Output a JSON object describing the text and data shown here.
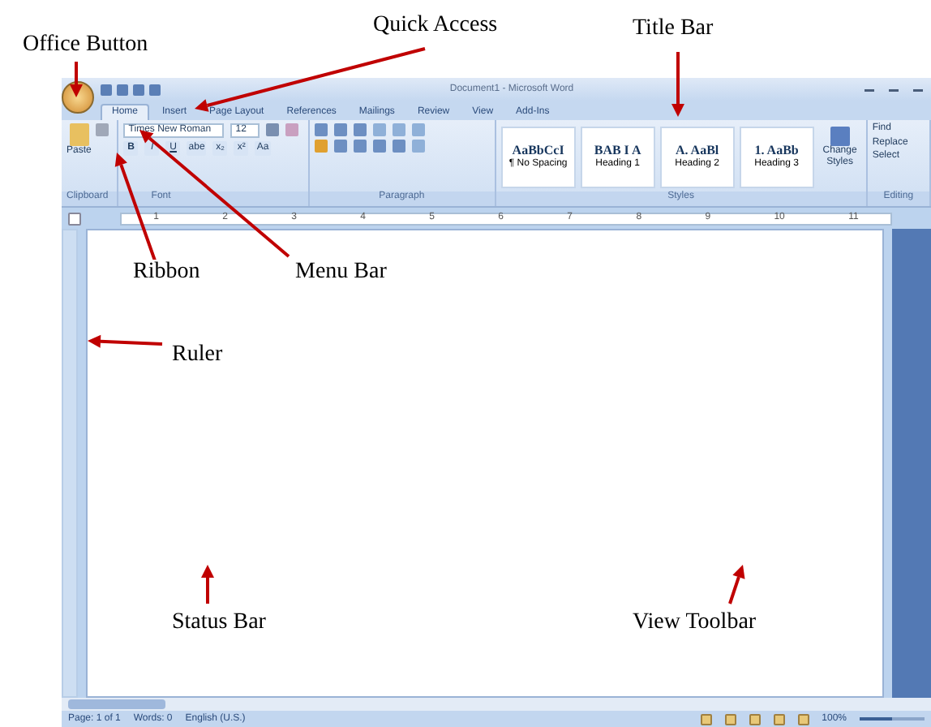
{
  "annotations": [
    {
      "label": "Office Button"
    },
    {
      "label": "Quick Access"
    },
    {
      "label": "Title Bar"
    },
    {
      "label": "Ribbon"
    },
    {
      "label": "Menu Bar"
    },
    {
      "label": "Ruler"
    },
    {
      "label": "Status Bar"
    },
    {
      "label": "View Toolbar"
    }
  ],
  "window": {
    "title": "Document1 - Microsoft Word"
  },
  "tabs": [
    {
      "label": "Home",
      "selected": true
    },
    {
      "label": "Insert",
      "selected": false
    },
    {
      "label": "Page Layout",
      "selected": false
    },
    {
      "label": "References",
      "selected": false
    },
    {
      "label": "Mailings",
      "selected": false
    },
    {
      "label": "Review",
      "selected": false
    },
    {
      "label": "View",
      "selected": false
    },
    {
      "label": "Add-Ins",
      "selected": false
    }
  ],
  "ribbon": {
    "paste_label": "Paste",
    "font_name": "Times New Roman",
    "font_size": "12",
    "font_buttons": [
      "B",
      "I",
      "U",
      "abe",
      "x₂",
      "x²",
      "Aa"
    ],
    "styles": [
      {
        "preview": "AaBbCcI",
        "name": "¶ No Spacing"
      },
      {
        "preview": "BAB I A",
        "name": "Heading 1"
      },
      {
        "preview": "A. AaBl",
        "name": "Heading 2"
      },
      {
        "preview": "1. AaBb",
        "name": "Heading 3"
      }
    ],
    "change_styles": "Change Styles",
    "editing": [
      "Find",
      "Replace",
      "Select"
    ],
    "groups": [
      "Clipboard",
      "Font",
      "Paragraph",
      "Styles",
      "Editing"
    ]
  },
  "ruler_marks": [
    "1",
    "2",
    "3",
    "4",
    "5",
    "6",
    "7",
    "8",
    "9",
    "10",
    "11"
  ],
  "status_bar": {
    "items": [
      "Page: 1 of 1",
      "Words: 0",
      "English (U.S.)"
    ],
    "zoom": "100%",
    "level": 0.5
  }
}
